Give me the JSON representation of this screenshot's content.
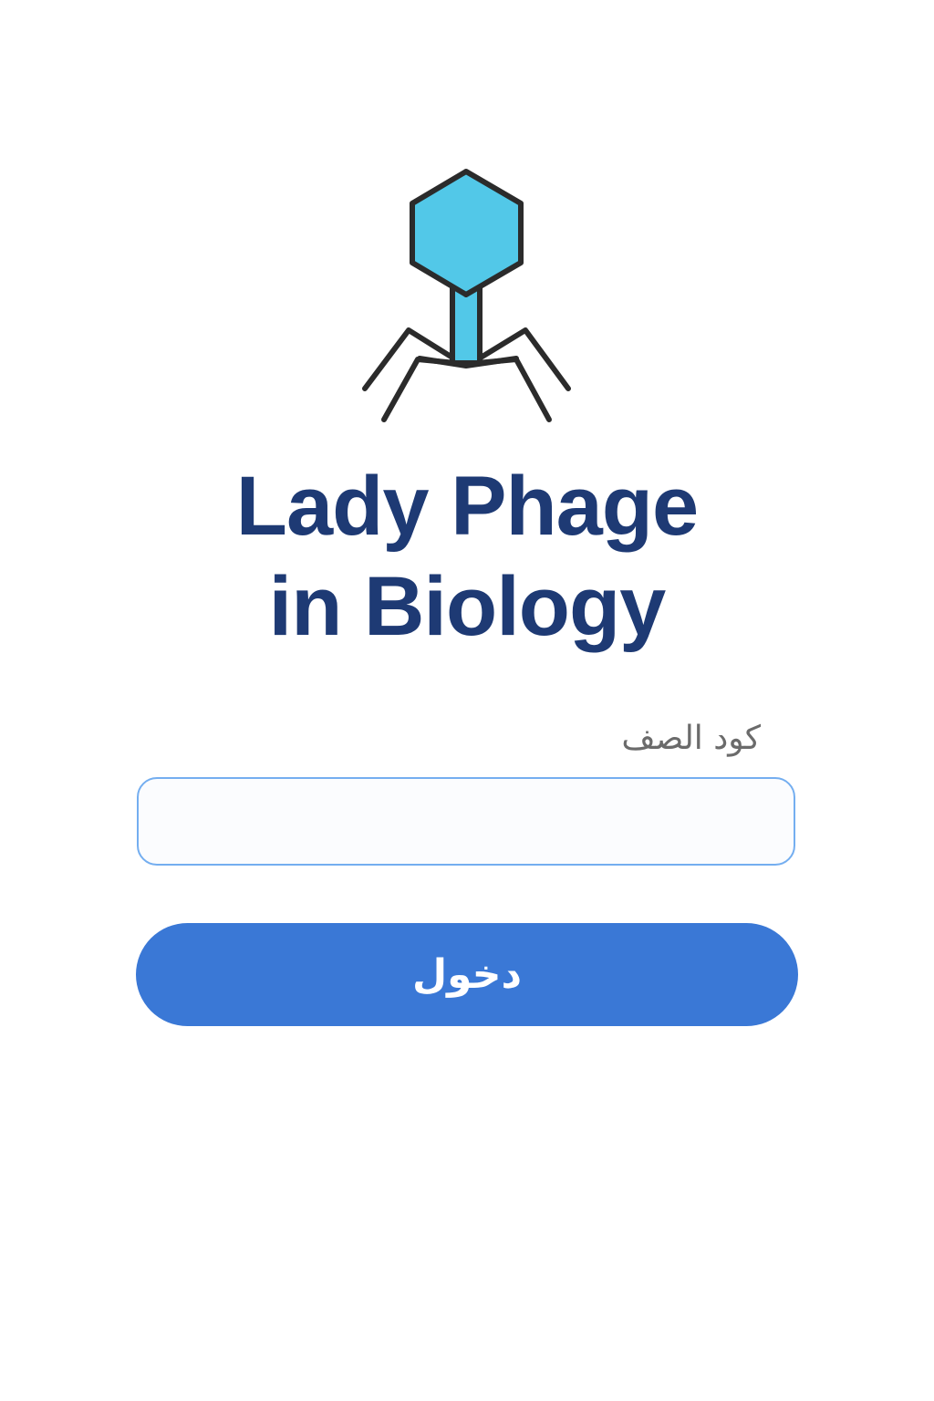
{
  "logo": {
    "icon": "bacteriophage-icon",
    "colors": {
      "head_fill": "#52c8e8",
      "outline": "#2b2b2b"
    }
  },
  "title": {
    "line1": "Lady Phage",
    "line2": "in Biology",
    "color": "#1e3a74"
  },
  "form": {
    "code_label": "كود الصف",
    "code_value": "",
    "code_placeholder": "",
    "submit_label": "دخول",
    "accent_color": "#3a78d6",
    "input_border_color": "#74aef0"
  }
}
